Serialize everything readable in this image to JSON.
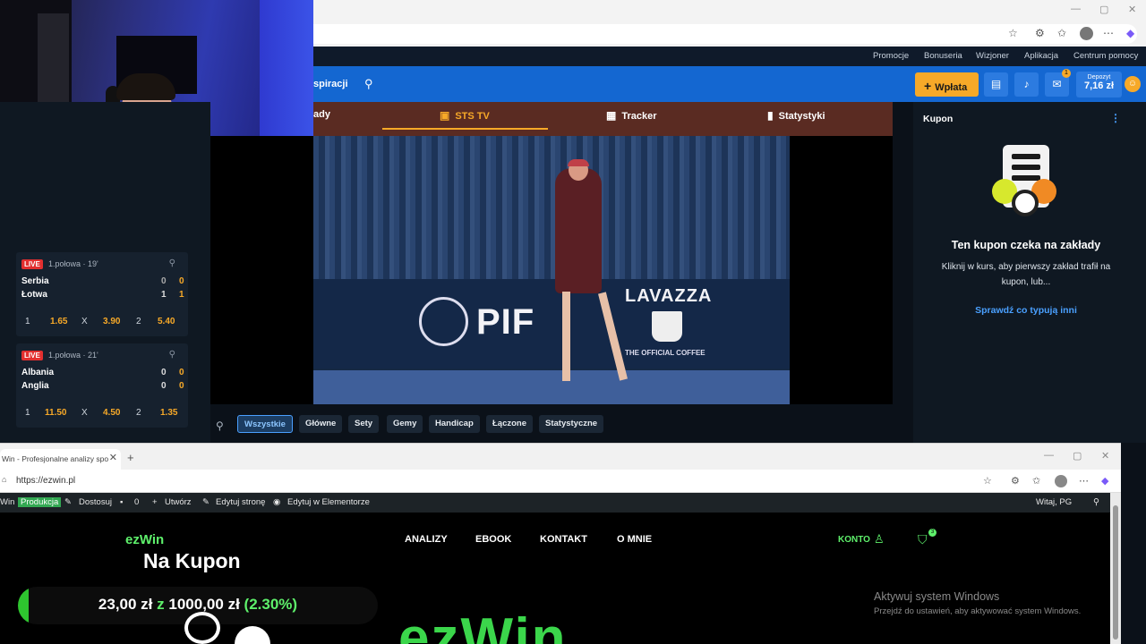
{
  "sts": {
    "top_nav": [
      "Promocje",
      "Bonuseria",
      "Wizjoner",
      "Aplikacja",
      "Centrum pomocy"
    ],
    "header": {
      "section_partial": "spiracji",
      "deposit_button": "Wpłata",
      "notification_badge": "1",
      "deposit_label": "Depozyt",
      "balance": "7,16 zł"
    },
    "stream_tabs": {
      "partial_first": "ady",
      "tv": "STS TV",
      "tracker": "Tracker",
      "stats": "Statystyki"
    },
    "matches": [
      {
        "live": "LIVE",
        "period": "1.połowa · 19'",
        "team1": "Serbia",
        "team2": "Łotwa",
        "s1a": "0",
        "s1b": "0",
        "s2a": "1",
        "s2b": "1",
        "o1l": "1",
        "o1": "1.65",
        "oxl": "X",
        "ox": "3.90",
        "o2l": "2",
        "o2": "5.40"
      },
      {
        "live": "LIVE",
        "period": "1.połowa · 21'",
        "team1": "Albania",
        "team2": "Anglia",
        "s1a": "0",
        "s1b": "0",
        "s2a": "0",
        "s2b": "0",
        "o1l": "1",
        "o1": "11.50",
        "oxl": "X",
        "ox": "4.50",
        "o2l": "2",
        "o2": "1.35"
      }
    ],
    "market_filters": [
      "Wszystkie",
      "Główne",
      "Sety",
      "Gemy",
      "Handicap",
      "Łączone",
      "Statystyczne"
    ],
    "video": {
      "sponsor1": "PIF",
      "sponsor2": "LAVAZZA",
      "sponsor2_sub": "THE OFFICIAL COFFEE"
    },
    "kupon": {
      "title": "Kupon",
      "heading": "Ten kupon czeka na zakłady",
      "description": "Kliknij w kurs, aby pierwszy zakład trafił na kupon, lub...",
      "link": "Sprawdź co typują inni"
    }
  },
  "ezwin_browser": {
    "tab_title": "Win - Profesjonalne analizy spo",
    "url": "https://ezwin.pl",
    "admin_bar": {
      "site": "Win",
      "env": "Produkcja",
      "customize": "Dostosuj",
      "comments": "0",
      "create": "Utwórz",
      "edit_page": "Edytuj stronę",
      "elementor": "Edytuj w Elementorze",
      "greeting": "Witaj, PG"
    }
  },
  "ezwin_site": {
    "logo": "ezWin",
    "nav": [
      "ANALIZY",
      "EBOOK",
      "KONTAKT",
      "O MNIE"
    ],
    "account": "KONTO",
    "cart_count": "3",
    "hero_text": "ezWin"
  },
  "windows_watermark": {
    "line1": "Aktywuj system Windows",
    "line2": "Przejdź do ustawień, aby aktywować system Windows."
  },
  "overlay": {
    "title": "Na Kupon",
    "current": "23,00 zł",
    "mid": "z",
    "target": "1000,00 zł",
    "percent": "(2.30%)",
    "progress_fraction": 0.023
  },
  "colors": {
    "sts_blue": "#1467d1",
    "sts_orange": "#f7a928",
    "ezwin_green": "#5ef06b",
    "live_red": "#e22f2f"
  }
}
